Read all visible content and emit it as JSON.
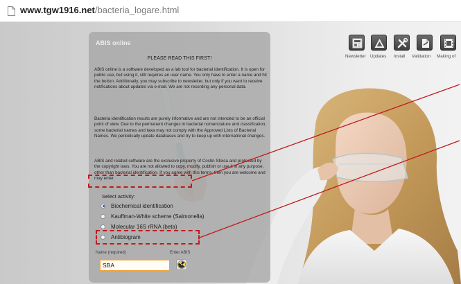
{
  "browser": {
    "url_host": "www.tgw1916.net",
    "url_path": "/bacteria_logare.html"
  },
  "panel": {
    "title": "ABIS online",
    "heading": "PLEASE READ THIS FIRST!",
    "paragraphs": [
      "ABIS online is a software developed as a lab tool for bacterial identification. It is open for public use, but using it, still requires an user name. You only have to enter a name and hit the button. Additionally, you may subscribe to newsletter, but only if you want to receive notifications about updates via e-mail. We are not recording any personal data.",
      "Bacteria identification results are purely informative and are not intended to be an official point of view. Due to the permanent changes in bacterial nomenclature and classification, some bacterial names and taxa may not comply with the Approved Lists of Bacterial Names. We periodically update databases and try to keep up with international changes.",
      "ABIS and related software are the exclusive property of Costin Stoica and protected by the copyright laws. You are not allowed to copy, modify, publish or use it in any purpose, other than bacterial identification. If you agree with this terms, then you are welcome and may enter."
    ],
    "activity_label": "Select activity:",
    "activities": [
      {
        "label": "Biochemical identification",
        "checked": true
      },
      {
        "label": "Kauffman-White scheme (Salmonella)",
        "checked": false
      },
      {
        "label": "Molecular 16S rRNA (beta)",
        "checked": false
      },
      {
        "label": "Antibiogram",
        "checked": false
      }
    ],
    "name_label": "Name (required)",
    "enter_label": "Enter ABIS",
    "name_value": "SBA",
    "enter_icon": "radiation-icon"
  },
  "toolbar": [
    {
      "label": "Newsletter",
      "icon": "newsletter-icon"
    },
    {
      "label": "Updates",
      "icon": "warning-triangle-icon"
    },
    {
      "label": "Install",
      "icon": "tools-icon"
    },
    {
      "label": "Validation",
      "icon": "document-icon"
    },
    {
      "label": "Making of",
      "icon": "film-icon"
    }
  ],
  "colors": {
    "callout": "#c0191c",
    "input_border": "#f2a33a",
    "panel": "#a6a6a6"
  }
}
